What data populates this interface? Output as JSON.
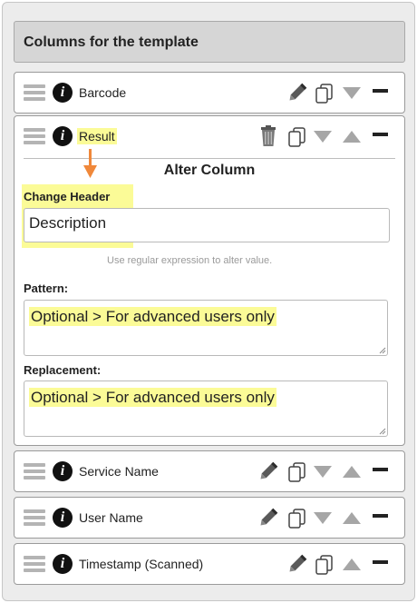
{
  "header": {
    "title": "Columns for the template"
  },
  "columns": [
    {
      "label": "Barcode"
    },
    {
      "label": "Result"
    },
    {
      "label": "Service Name"
    },
    {
      "label": "User Name"
    },
    {
      "label": "Timestamp (Scanned)"
    }
  ],
  "alter": {
    "title": "Alter Column",
    "change_header_label": "Change Header",
    "change_header_value": "Description",
    "hint": "Use regular expression to alter value.",
    "pattern_label": "Pattern:",
    "pattern_value": "Optional > For advanced users only",
    "replacement_label": "Replacement:",
    "replacement_value": "Optional > For advanced users only"
  },
  "colors": {
    "highlight": "#fbfb97",
    "arrow": "#f0883a",
    "header_bg": "#d6d6d6"
  },
  "icons": [
    "drag-handle-icon",
    "info-icon",
    "pencil-icon",
    "copy-icon",
    "trash-icon",
    "move-down-icon",
    "move-up-icon",
    "remove-icon"
  ]
}
